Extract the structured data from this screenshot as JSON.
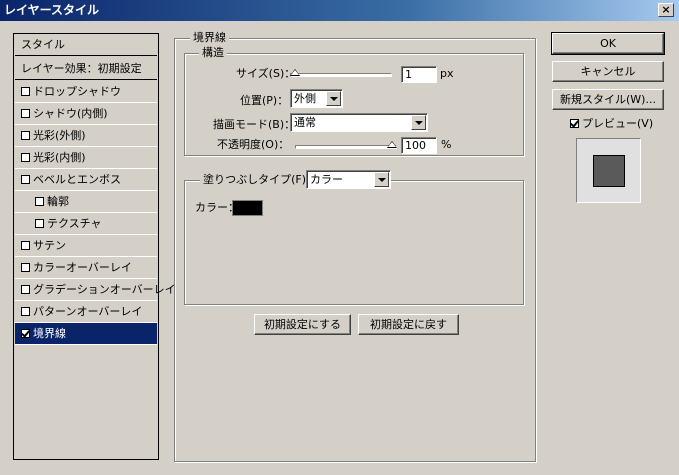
{
  "window": {
    "title": "レイヤースタイル",
    "close_label": "×"
  },
  "style_list": {
    "header": "スタイル",
    "blending": "レイヤー効果：初期設定",
    "items": [
      {
        "label": "ドロップシャドウ",
        "checked": false
      },
      {
        "label": "シャドウ(内側)",
        "checked": false
      },
      {
        "label": "光彩(外側)",
        "checked": false
      },
      {
        "label": "光彩(内側)",
        "checked": false
      },
      {
        "label": "ベベルとエンボス",
        "checked": false
      },
      {
        "label": "輪郭",
        "checked": false
      },
      {
        "label": "テクスチャ",
        "checked": false
      },
      {
        "label": "サテン",
        "checked": false
      },
      {
        "label": "カラーオーバーレイ",
        "checked": false
      },
      {
        "label": "グラデーションオーバーレイ",
        "checked": false
      },
      {
        "label": "パターンオーバーレイ",
        "checked": false
      },
      {
        "label": "境界線",
        "checked": true
      }
    ]
  },
  "stroke": {
    "section_title": "境界線",
    "structure_title": "構造",
    "size_label": "サイズ(S)：",
    "size_value": "1",
    "size_unit": "px",
    "position_label": "位置(P)：",
    "position_value": "外側",
    "blend_label": "描画モード(B)：",
    "blend_value": "通常",
    "opacity_label": "不透明度(O)：",
    "opacity_value": "100",
    "opacity_unit": "%",
    "fill_type_label": "塗りつぶしタイプ(F)：",
    "fill_type_value": "カラー",
    "color_label": "カラー：",
    "color_swatch": "#000000",
    "make_default": "初期設定にする",
    "reset_default": "初期設定に戻す"
  },
  "actions": {
    "ok": "OK",
    "cancel": "キャンセル",
    "new_style": "新規スタイル(W)...",
    "preview_label": "プレビュー(V)",
    "preview_checked": true
  },
  "colors": {
    "selection": "#0a246a",
    "preview_swatch": "#5a5a5a"
  }
}
